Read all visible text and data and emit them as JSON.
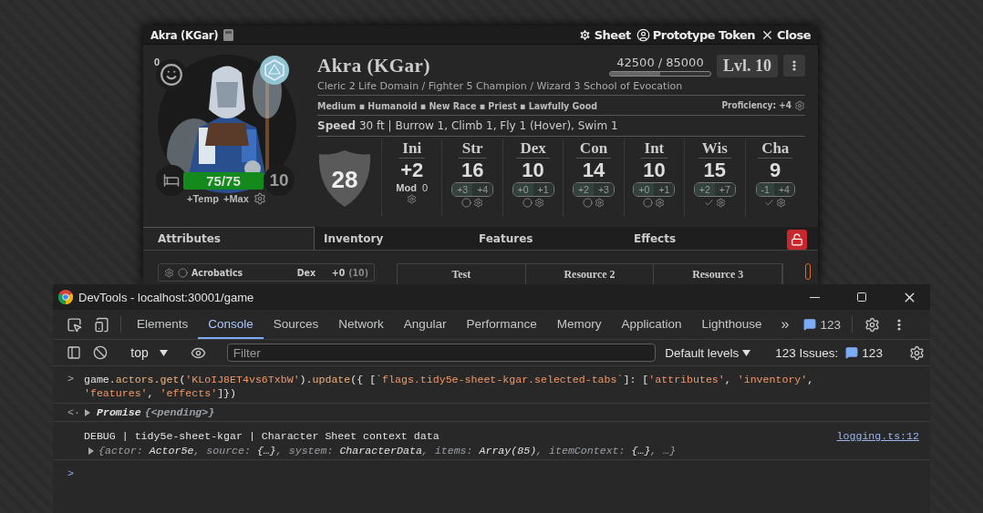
{
  "sheet_window": {
    "title": "Akra (KGar)",
    "header_buttons": [
      {
        "kind": "gear",
        "label": "Sheet"
      },
      {
        "kind": "user",
        "label": "Prototype Token"
      },
      {
        "kind": "close",
        "label": "Close"
      }
    ],
    "portrait": {
      "kind": "picture",
      "inspiration": "0",
      "hp": {
        "value": "75/75",
        "level": 1
      },
      "hit_dice": "10",
      "hp_links": [
        "+Temp",
        "+Max"
      ]
    },
    "name": "Akra (KGar)",
    "xp": {
      "value": "42500 / 85000",
      "level": 0.5
    },
    "level": "Lvl. 10",
    "classes": "Cleric 2 Life Domain / Fighter 5 Champion / Wizard 3 School of Evocation",
    "traits": "Medium ▪ Humanoid ▪ New Race ▪ Priest ▪ Lawfully Good",
    "proficiency": "Proficiency: +4",
    "speed_label": "Speed",
    "speed": "30 ft | Burrow 1, Climb 1, Fly 1 (Hover), Swim 1",
    "armor_class": "28",
    "initiative": {
      "label": "Ini",
      "value": "+2",
      "mod_label": "Mod",
      "mod": "0"
    },
    "abilities": [
      {
        "label": "Str",
        "score": "16",
        "mod": "+3",
        "save": "+4",
        "proficient": false
      },
      {
        "label": "Dex",
        "score": "10",
        "mod": "+0",
        "save": "+1",
        "proficient": false
      },
      {
        "label": "Con",
        "score": "14",
        "mod": "+2",
        "save": "+3",
        "proficient": false
      },
      {
        "label": "Int",
        "score": "10",
        "mod": "+0",
        "save": "+1",
        "proficient": false
      },
      {
        "label": "Wis",
        "score": "15",
        "mod": "+2",
        "save": "+7",
        "proficient": true
      },
      {
        "label": "Cha",
        "score": "9",
        "mod": "-1",
        "save": "+4",
        "proficient": true
      }
    ],
    "tabs": [
      {
        "label": "Attributes",
        "selected": true
      },
      {
        "label": "Inventory",
        "selected": false
      },
      {
        "label": "Features",
        "selected": false
      },
      {
        "label": "Effects",
        "selected": false
      }
    ],
    "skill": {
      "name": "Acrobatics",
      "ability": "Dex",
      "mod": "+0",
      "passive": "(10)",
      "proficient": false
    },
    "resources": [
      "Test",
      "Resource 2",
      "Resource 3"
    ]
  },
  "devtools": {
    "title": "DevTools - localhost:30001/game",
    "tabs": [
      {
        "label": "Elements",
        "selected": false
      },
      {
        "label": "Console",
        "selected": true
      },
      {
        "label": "Sources",
        "selected": false
      },
      {
        "label": "Network",
        "selected": false
      },
      {
        "label": "Angular",
        "selected": false
      },
      {
        "label": "Performance",
        "selected": false
      },
      {
        "label": "Memory",
        "selected": false
      },
      {
        "label": "Application",
        "selected": false
      },
      {
        "label": "Lighthouse",
        "selected": false
      }
    ],
    "more": "»",
    "message_count": "123",
    "context": "top",
    "filter_placeholder": "Filter",
    "levels": "Default levels",
    "issues_label": "123 Issues:",
    "issues_count": "123",
    "console": [
      {
        "kind": "input",
        "prompt": ">",
        "tokens": [
          {
            "kind": "plain",
            "text": "game."
          },
          {
            "kind": "prop",
            "text": "actors"
          },
          {
            "kind": "plain",
            "text": "."
          },
          {
            "kind": "prop",
            "text": "get"
          },
          {
            "kind": "plain",
            "text": "("
          },
          {
            "kind": "string",
            "text": "'KLoIJ8ET4vs6TxbW'"
          },
          {
            "kind": "plain",
            "text": ")."
          },
          {
            "kind": "prop",
            "text": "update"
          },
          {
            "kind": "plain",
            "text": "({ ["
          },
          {
            "kind": "string",
            "text": "`flags.tidy5e-sheet-kgar.selected-tabs`"
          },
          {
            "kind": "plain",
            "text": "]: ["
          },
          {
            "kind": "string",
            "text": "'attributes'"
          },
          {
            "kind": "plain",
            "text": ", "
          },
          {
            "kind": "string",
            "text": "'inventory'"
          },
          {
            "kind": "plain",
            "text": ", "
          },
          {
            "kind": "string",
            "text": "'features'"
          },
          {
            "kind": "plain",
            "text": ", "
          },
          {
            "kind": "string",
            "text": "'effects'"
          },
          {
            "kind": "plain",
            "text": "]})"
          }
        ]
      },
      {
        "kind": "result",
        "prompt": "<·",
        "tokens": [
          {
            "kind": "object",
            "text": "Promise "
          },
          {
            "kind": "key",
            "text": "{<pending>}"
          }
        ]
      },
      {
        "kind": "log",
        "text": "DEBUG | tidy5e-sheet-kgar | Character Sheet context data",
        "link": "logging.ts:12",
        "tokens": [
          {
            "kind": "key",
            "text": "{"
          },
          {
            "kind": "key",
            "text": "actor: "
          },
          {
            "kind": "object",
            "text": "Actor5e"
          },
          {
            "kind": "key",
            "text": ", source: "
          },
          {
            "kind": "object",
            "text": "{…}"
          },
          {
            "kind": "key",
            "text": ", system: "
          },
          {
            "kind": "object",
            "text": "CharacterData"
          },
          {
            "kind": "key",
            "text": ", items: "
          },
          {
            "kind": "object",
            "text": "Array(85)"
          },
          {
            "kind": "key",
            "text": ", itemContext: "
          },
          {
            "kind": "object",
            "text": "{…}"
          },
          {
            "kind": "key",
            "text": ", …}"
          }
        ]
      },
      {
        "kind": "prompt",
        "prompt": ">"
      }
    ]
  }
}
